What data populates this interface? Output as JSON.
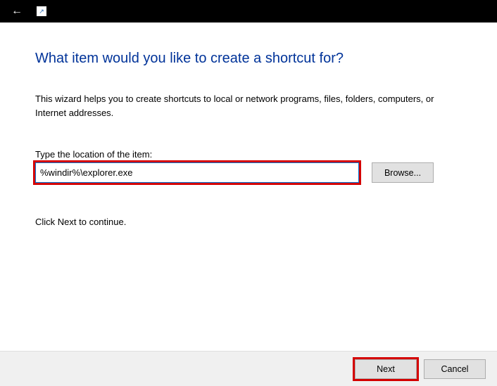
{
  "heading": "What item would you like to create a shortcut for?",
  "description": "This wizard helps you to create shortcuts to local or network programs, files, folders, computers, or Internet addresses.",
  "field_label": "Type the location of the item:",
  "location_value": "%windir%\\explorer.exe",
  "browse_label": "Browse...",
  "continue_text": "Click Next to continue.",
  "footer": {
    "next_label": "Next",
    "cancel_label": "Cancel"
  }
}
